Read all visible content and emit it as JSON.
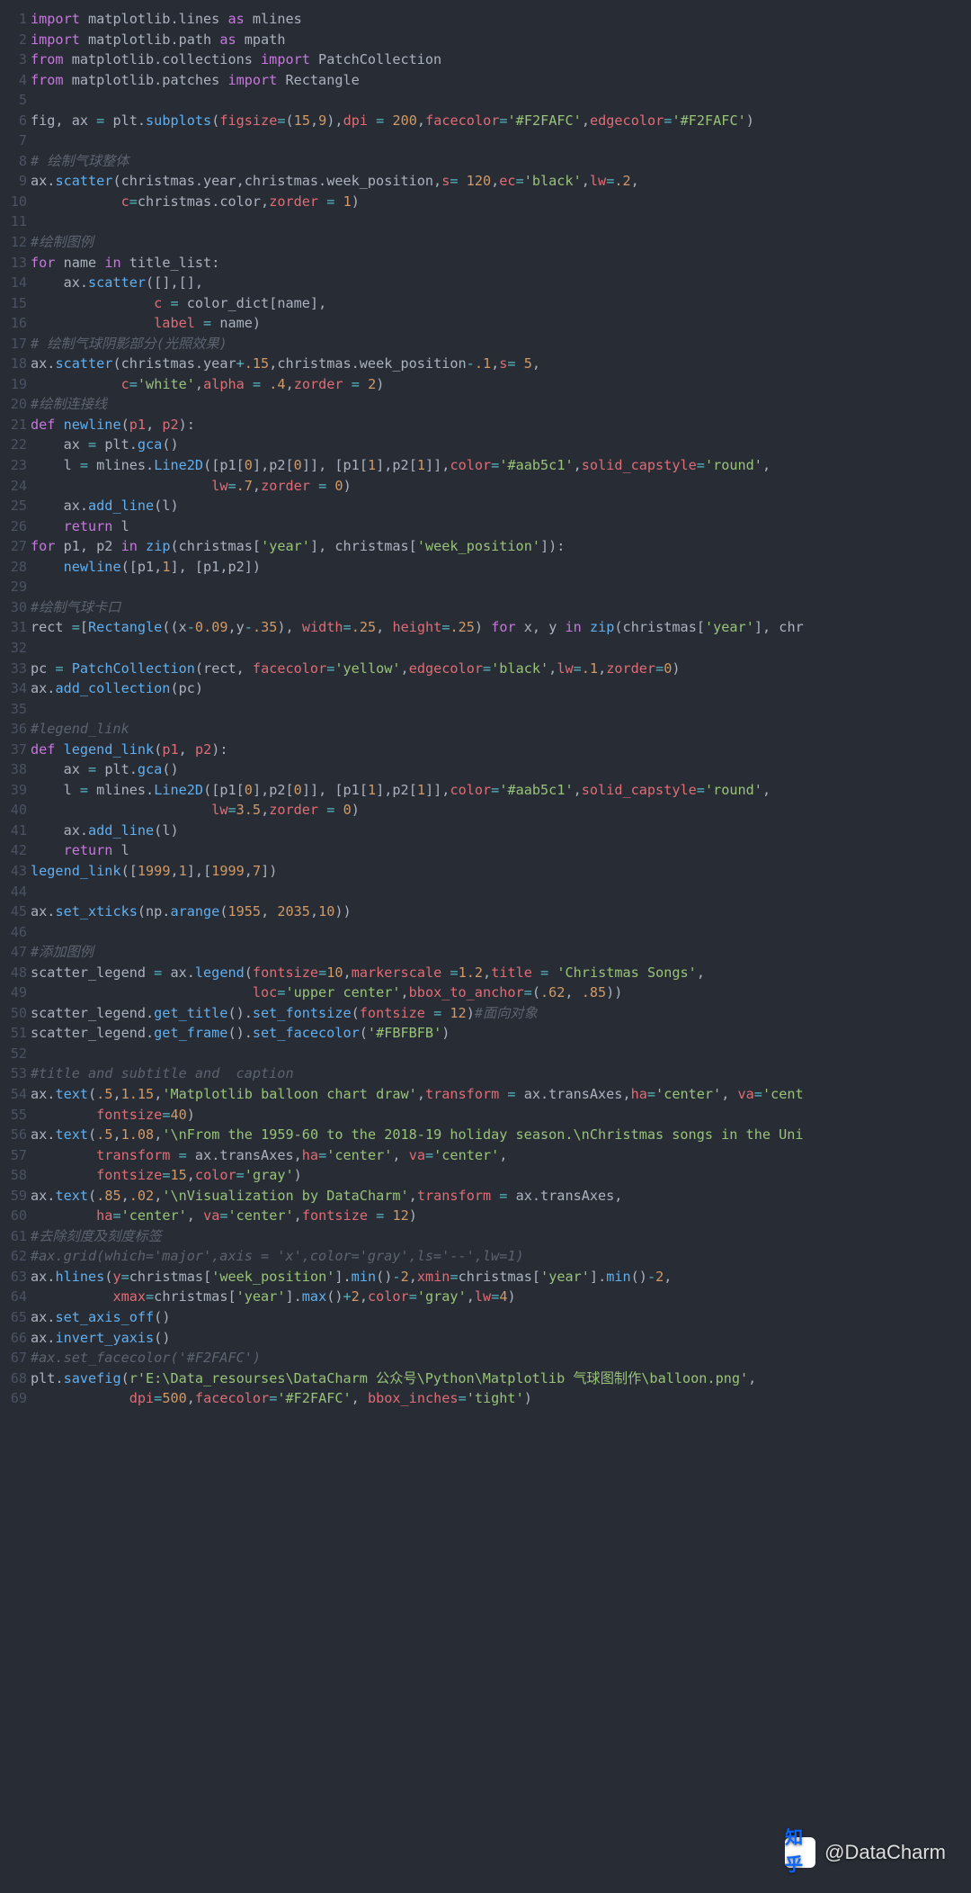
{
  "watermark": {
    "site": "知乎",
    "handle": "@DataCharm"
  },
  "code": [
    {
      "n": 1,
      "h": "<span class='kw'>import</span> matplotlib.lines <span class='kw'>as</span> mlines"
    },
    {
      "n": 2,
      "h": "<span class='kw'>import</span> matplotlib.path <span class='kw'>as</span> mpath"
    },
    {
      "n": 3,
      "h": "<span class='kw'>from</span> matplotlib.collections <span class='kw'>import</span> PatchCollection"
    },
    {
      "n": 4,
      "h": "<span class='kw'>from</span> matplotlib.patches <span class='kw'>import</span> Rectangle"
    },
    {
      "n": 5,
      "h": ""
    },
    {
      "n": 6,
      "h": "fig, ax <span class='op'>=</span> plt.<span class='fn'>subplots</span>(<span class='nm'>figsize</span><span class='op'>=</span>(<span class='num'>15</span>,<span class='num'>9</span>),<span class='nm'>dpi</span> <span class='op'>=</span> <span class='num'>200</span>,<span class='nm'>facecolor</span><span class='op'>=</span><span class='str'>'#F2FAFC'</span>,<span class='nm'>edgecolor</span><span class='op'>=</span><span class='str'>'#F2FAFC'</span>)"
    },
    {
      "n": 7,
      "h": ""
    },
    {
      "n": 8,
      "h": "<span class='cmt'># 绘制气球整体</span>"
    },
    {
      "n": 9,
      "h": "ax.<span class='fn'>scatter</span>(christmas.year,christmas.week_position,<span class='nm'>s</span><span class='op'>=</span> <span class='num'>120</span>,<span class='nm'>ec</span><span class='op'>=</span><span class='str'>'black'</span>,<span class='nm'>lw</span><span class='op'>=</span><span class='num'>.2</span>,"
    },
    {
      "n": 10,
      "h": "           <span class='nm'>c</span><span class='op'>=</span>christmas.color,<span class='nm'>zorder</span> <span class='op'>=</span> <span class='num'>1</span>)"
    },
    {
      "n": 11,
      "h": ""
    },
    {
      "n": 12,
      "h": "<span class='cmt'>#绘制图例</span>"
    },
    {
      "n": 13,
      "h": "<span class='kw'>for</span> name <span class='kw'>in</span> title_list:"
    },
    {
      "n": 14,
      "h": "    ax.<span class='fn'>scatter</span>([],[],"
    },
    {
      "n": 15,
      "h": "               <span class='nm'>c</span> <span class='op'>=</span> color_dict[name],"
    },
    {
      "n": 16,
      "h": "               <span class='nm'>label</span> <span class='op'>=</span> name)"
    },
    {
      "n": 17,
      "h": "<span class='cmt'># 绘制气球阴影部分(光照效果)</span>"
    },
    {
      "n": 18,
      "h": "ax.<span class='fn'>scatter</span>(christmas.year<span class='op'>+</span><span class='num'>.15</span>,christmas.week_position<span class='op'>-</span><span class='num'>.1</span>,<span class='nm'>s</span><span class='op'>=</span> <span class='num'>5</span>,"
    },
    {
      "n": 19,
      "h": "           <span class='nm'>c</span><span class='op'>=</span><span class='str'>'white'</span>,<span class='nm'>alpha</span> <span class='op'>=</span> <span class='num'>.4</span>,<span class='nm'>zorder</span> <span class='op'>=</span> <span class='num'>2</span>)"
    },
    {
      "n": 20,
      "h": "<span class='cmt'>#绘制连接线</span>"
    },
    {
      "n": 21,
      "h": "<span class='kw'>def</span> <span class='fn'>newline</span>(<span class='nm'>p1</span>, <span class='nm'>p2</span>):"
    },
    {
      "n": 22,
      "h": "    ax <span class='op'>=</span> plt.<span class='fn'>gca</span>()"
    },
    {
      "n": 23,
      "h": "    l <span class='op'>=</span> mlines.<span class='fn'>Line2D</span>([p1[<span class='num'>0</span>],p2[<span class='num'>0</span>]], [p1[<span class='num'>1</span>],p2[<span class='num'>1</span>]],<span class='nm'>color</span><span class='op'>=</span><span class='str'>'#aab5c1'</span>,<span class='nm'>solid_capstyle</span><span class='op'>=</span><span class='str'>'round'</span>,"
    },
    {
      "n": 24,
      "h": "                      <span class='nm'>lw</span><span class='op'>=</span><span class='num'>.7</span>,<span class='nm'>zorder</span> <span class='op'>=</span> <span class='num'>0</span>)"
    },
    {
      "n": 25,
      "h": "    ax.<span class='fn'>add_line</span>(l)"
    },
    {
      "n": 26,
      "h": "    <span class='kw'>return</span> l"
    },
    {
      "n": 27,
      "h": "<span class='kw'>for</span> p1, p2 <span class='kw'>in</span> <span class='fn'>zip</span>(christmas[<span class='str'>'year'</span>], christmas[<span class='str'>'week_position'</span>]):"
    },
    {
      "n": 28,
      "h": "    <span class='fn'>newline</span>([p1,<span class='num'>1</span>], [p1,p2])"
    },
    {
      "n": 29,
      "h": ""
    },
    {
      "n": 30,
      "h": "<span class='cmt'>#绘制气球卡口</span>"
    },
    {
      "n": 31,
      "h": "rect <span class='op'>=</span>[<span class='fn'>Rectangle</span>((x<span class='op'>-</span><span class='num'>0.09</span>,y<span class='op'>-</span><span class='num'>.35</span>), <span class='nm'>width</span><span class='op'>=</span><span class='num'>.25</span>, <span class='nm'>height</span><span class='op'>=</span><span class='num'>.25</span>) <span class='kw'>for</span> x, y <span class='kw'>in</span> <span class='fn'>zip</span>(christmas[<span class='str'>'year'</span>], chr"
    },
    {
      "n": 32,
      "h": ""
    },
    {
      "n": 33,
      "h": "pc <span class='op'>=</span> <span class='fn'>PatchCollection</span>(rect, <span class='nm'>facecolor</span><span class='op'>=</span><span class='str'>'yellow'</span>,<span class='nm'>edgecolor</span><span class='op'>=</span><span class='str'>'black'</span>,<span class='nm'>lw</span><span class='op'>=</span><span class='num'>.1</span>,<span class='nm'>zorder</span><span class='op'>=</span><span class='num'>0</span>)"
    },
    {
      "n": 34,
      "h": "ax.<span class='fn'>add_collection</span>(pc)"
    },
    {
      "n": 35,
      "h": ""
    },
    {
      "n": 36,
      "h": "<span class='cmt'>#legend_link</span>"
    },
    {
      "n": 37,
      "h": "<span class='kw'>def</span> <span class='fn'>legend_link</span>(<span class='nm'>p1</span>, <span class='nm'>p2</span>):"
    },
    {
      "n": 38,
      "h": "    ax <span class='op'>=</span> plt.<span class='fn'>gca</span>()"
    },
    {
      "n": 39,
      "h": "    l <span class='op'>=</span> mlines.<span class='fn'>Line2D</span>([p1[<span class='num'>0</span>],p2[<span class='num'>0</span>]], [p1[<span class='num'>1</span>],p2[<span class='num'>1</span>]],<span class='nm'>color</span><span class='op'>=</span><span class='str'>'#aab5c1'</span>,<span class='nm'>solid_capstyle</span><span class='op'>=</span><span class='str'>'round'</span>,"
    },
    {
      "n": 40,
      "h": "                      <span class='nm'>lw</span><span class='op'>=</span><span class='num'>3.5</span>,<span class='nm'>zorder</span> <span class='op'>=</span> <span class='num'>0</span>)"
    },
    {
      "n": 41,
      "h": "    ax.<span class='fn'>add_line</span>(l)"
    },
    {
      "n": 42,
      "h": "    <span class='kw'>return</span> l"
    },
    {
      "n": 43,
      "h": "<span class='fn'>legend_link</span>([<span class='num'>1999</span>,<span class='num'>1</span>],[<span class='num'>1999</span>,<span class='num'>7</span>])"
    },
    {
      "n": 44,
      "h": ""
    },
    {
      "n": 45,
      "h": "ax.<span class='fn'>set_xticks</span>(np.<span class='fn'>arange</span>(<span class='num'>1955</span>, <span class='num'>2035</span>,<span class='num'>10</span>))"
    },
    {
      "n": 46,
      "h": ""
    },
    {
      "n": 47,
      "h": "<span class='cmt'>#添加图例</span>"
    },
    {
      "n": 48,
      "h": "scatter_legend <span class='op'>=</span> ax.<span class='fn'>legend</span>(<span class='nm'>fontsize</span><span class='op'>=</span><span class='num'>10</span>,<span class='nm'>markerscale</span> <span class='op'>=</span><span class='num'>1.2</span>,<span class='nm'>title</span> <span class='op'>=</span> <span class='str'>'Christmas Songs'</span>,"
    },
    {
      "n": 49,
      "h": "                           <span class='nm'>loc</span><span class='op'>=</span><span class='str'>'upper center'</span>,<span class='nm'>bbox_to_anchor</span><span class='op'>=</span>(<span class='num'>.62</span>, <span class='num'>.85</span>))"
    },
    {
      "n": 50,
      "h": "scatter_legend.<span class='fn'>get_title</span>().<span class='fn'>set_fontsize</span>(<span class='nm'>fontsize</span> <span class='op'>=</span> <span class='num'>12</span>)<span class='cmt'>#面向对象</span>"
    },
    {
      "n": 51,
      "h": "scatter_legend.<span class='fn'>get_frame</span>().<span class='fn'>set_facecolor</span>(<span class='str'>'#FBFBFB'</span>)"
    },
    {
      "n": 52,
      "h": ""
    },
    {
      "n": 53,
      "h": "<span class='cmt'>#title and subtitle and  caption</span>"
    },
    {
      "n": 54,
      "h": "ax.<span class='fn'>text</span>(<span class='num'>.5</span>,<span class='num'>1.15</span>,<span class='str'>'Matplotlib balloon chart draw'</span>,<span class='nm'>transform</span> <span class='op'>=</span> ax.transAxes,<span class='nm'>ha</span><span class='op'>=</span><span class='str'>'center'</span>, <span class='nm'>va</span><span class='op'>=</span><span class='str'>'cent</span>"
    },
    {
      "n": 55,
      "h": "        <span class='nm'>fontsize</span><span class='op'>=</span><span class='num'>40</span>)"
    },
    {
      "n": 56,
      "h": "ax.<span class='fn'>text</span>(<span class='num'>.5</span>,<span class='num'>1.08</span>,<span class='str'>'\\nFrom the 1959-60 to the 2018-19 holiday season.\\nChristmas songs in the Uni</span>"
    },
    {
      "n": 57,
      "h": "        <span class='nm'>transform</span> <span class='op'>=</span> ax.transAxes,<span class='nm'>ha</span><span class='op'>=</span><span class='str'>'center'</span>, <span class='nm'>va</span><span class='op'>=</span><span class='str'>'center'</span>,"
    },
    {
      "n": 58,
      "h": "        <span class='nm'>fontsize</span><span class='op'>=</span><span class='num'>15</span>,<span class='nm'>color</span><span class='op'>=</span><span class='str'>'gray'</span>)"
    },
    {
      "n": 59,
      "h": "ax.<span class='fn'>text</span>(<span class='num'>.85</span>,<span class='num'>.02</span>,<span class='str'>'\\nVisualization by DataCharm'</span>,<span class='nm'>transform</span> <span class='op'>=</span> ax.transAxes,"
    },
    {
      "n": 60,
      "h": "        <span class='nm'>ha</span><span class='op'>=</span><span class='str'>'center'</span>, <span class='nm'>va</span><span class='op'>=</span><span class='str'>'center'</span>,<span class='nm'>fontsize</span> <span class='op'>=</span> <span class='num'>12</span>)"
    },
    {
      "n": 61,
      "h": "<span class='cmt'>#去除刻度及刻度标签</span>"
    },
    {
      "n": 62,
      "h": "<span class='cmt'>#ax.grid(which='major',axis = 'x',color='gray',ls='--',lw=1)</span>"
    },
    {
      "n": 63,
      "h": "ax.<span class='fn'>hlines</span>(<span class='nm'>y</span><span class='op'>=</span>christmas[<span class='str'>'week_position'</span>].<span class='fn'>min</span>()<span class='op'>-</span><span class='num'>2</span>,<span class='nm'>xmin</span><span class='op'>=</span>christmas[<span class='str'>'year'</span>].<span class='fn'>min</span>()<span class='op'>-</span><span class='num'>2</span>,"
    },
    {
      "n": 64,
      "h": "          <span class='nm'>xmax</span><span class='op'>=</span>christmas[<span class='str'>'year'</span>].<span class='fn'>max</span>()<span class='op'>+</span><span class='num'>2</span>,<span class='nm'>color</span><span class='op'>=</span><span class='str'>'gray'</span>,<span class='nm'>lw</span><span class='op'>=</span><span class='num'>4</span>)"
    },
    {
      "n": 65,
      "h": "ax.<span class='fn'>set_axis_off</span>()"
    },
    {
      "n": 66,
      "h": "ax.<span class='fn'>invert_yaxis</span>()"
    },
    {
      "n": 67,
      "h": "<span class='cmt'>#ax.set_facecolor('#F2FAFC')</span>"
    },
    {
      "n": 68,
      "h": "plt.<span class='fn'>savefig</span>(<span class='str'>r'E:\\Data_resourses\\DataCharm 公众号\\Python\\Matplotlib 气球图制作\\balloon.png'</span>,"
    },
    {
      "n": 69,
      "h": "            <span class='nm'>dpi</span><span class='op'>=</span><span class='num'>500</span>,<span class='nm'>facecolor</span><span class='op'>=</span><span class='str'>'#F2FAFC'</span>, <span class='nm'>bbox_inches</span><span class='op'>=</span><span class='str'>'tight'</span>)"
    }
  ]
}
